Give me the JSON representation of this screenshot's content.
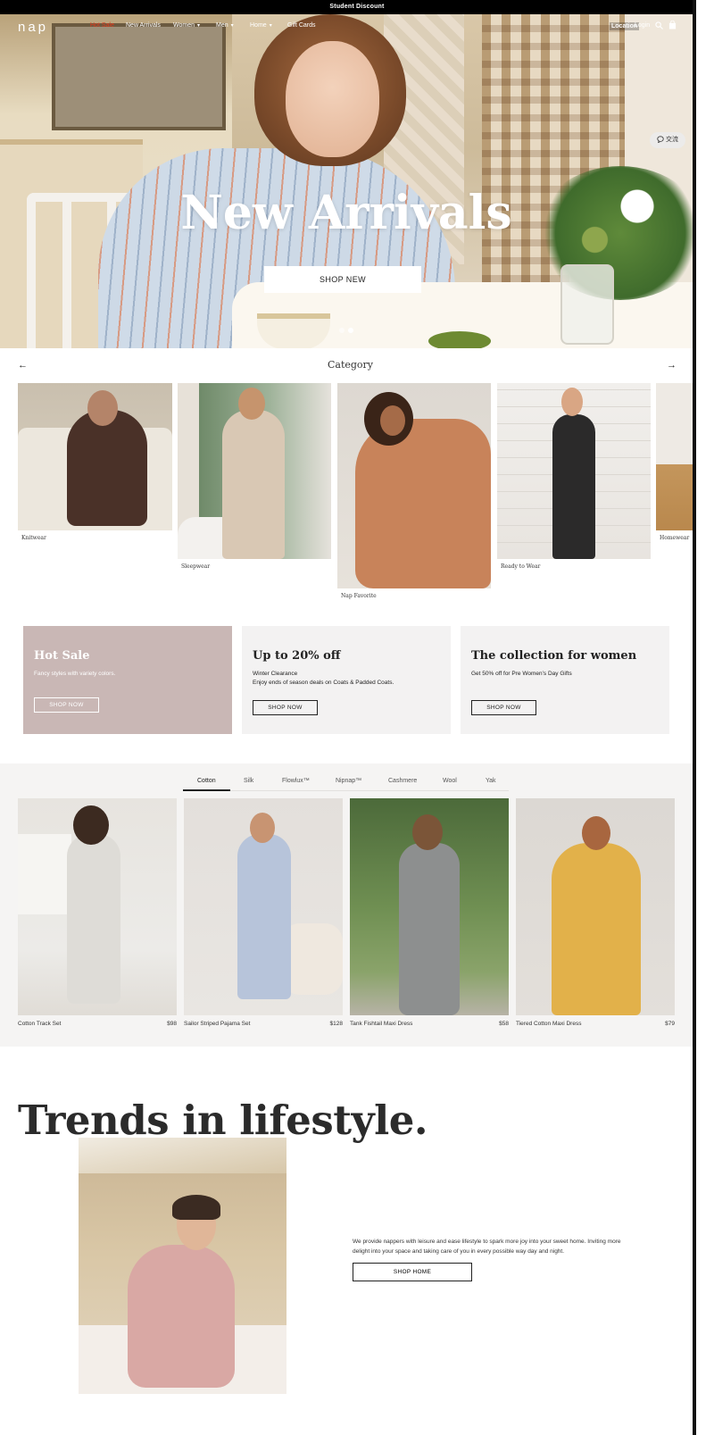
{
  "topbar": {
    "text": "Student Discount"
  },
  "nav": {
    "logo": "nap",
    "items": [
      {
        "label": "Hot Sale",
        "dropdown": false
      },
      {
        "label": "New Arrivals",
        "dropdown": false
      },
      {
        "label": "Women",
        "dropdown": true
      },
      {
        "label": "Men",
        "dropdown": true
      },
      {
        "label": "Home",
        "dropdown": true
      },
      {
        "label": "Gift Cards",
        "dropdown": false
      }
    ],
    "location": "Location",
    "login": "Login"
  },
  "hero": {
    "title": "New Arrivals",
    "button": "SHOP NEW",
    "slides": 2,
    "active_slide": 2
  },
  "chat": {
    "label": "交流"
  },
  "category": {
    "title": "Category",
    "prev": "←",
    "next": "→",
    "items": [
      {
        "label": "Knitwear"
      },
      {
        "label": "Sleepwear"
      },
      {
        "label": "Nap Favorite"
      },
      {
        "label": "Ready to Wear"
      },
      {
        "label": "Homewear"
      }
    ]
  },
  "promos": [
    {
      "title": "Hot Sale",
      "lines": [
        "Fancy styles with variety colors."
      ],
      "button": "SHOP NOW",
      "bg": "#c9b7b5",
      "fg": "#ffffff"
    },
    {
      "title": "Up to 20% off",
      "lines": [
        "Winter Clearance",
        "Enjoy ends of season deals on Coats & Padded Coats."
      ],
      "button": "SHOP NOW",
      "bg": "#f3f2f2",
      "fg": "#222222"
    },
    {
      "title": "The collection for women",
      "lines": [
        "Get 50% off for Pre Women’s Day Gifts"
      ],
      "button": "SHOP NOW",
      "bg": "#f3f2f2",
      "fg": "#222222"
    }
  ],
  "tabs": [
    "Cotton",
    "Silk",
    "Flowlux™",
    "Nipnap™",
    "Cashmere",
    "Wool",
    "Yak"
  ],
  "active_tab": "Cotton",
  "products": [
    {
      "name": "Cotton Track Set",
      "price": "$98"
    },
    {
      "name": "Sailor Striped Pajama Set",
      "price": "$128"
    },
    {
      "name": "Tank Fishtail Maxi Dress",
      "price": "$58"
    },
    {
      "name": "Tiered Cotton Maxi Dress",
      "price": "$79"
    }
  ],
  "lifestyle": {
    "title": "Trends in lifestyle.",
    "text": "We provide nappers with leisure and ease lifestyle to spark more joy into your sweet home. Inviting more delight into your space and taking care of you in every possible way day and night.",
    "button": "SHOP HOME"
  },
  "colors": {
    "accent": "#e4391b",
    "dark": "#222222",
    "section_bg": "#f5f4f3"
  }
}
